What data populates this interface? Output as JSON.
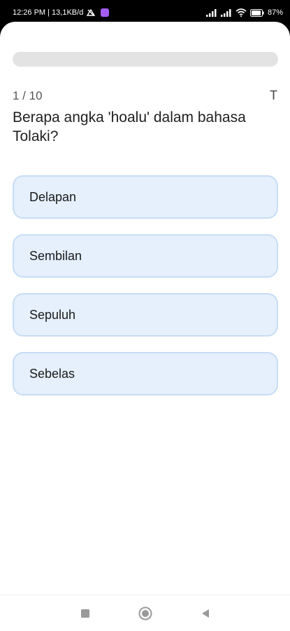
{
  "status_bar": {
    "time_network": "12:26 PM | 13,1KB/d",
    "battery": "87"
  },
  "quiz": {
    "counter": "1 / 10",
    "font_toggle": "T",
    "question": "Berapa angka 'hoalu' dalam bahasa Tolaki?",
    "progress_fraction": 0.0,
    "options": [
      "Delapan",
      "Sembilan",
      "Sepuluh",
      "Sebelas"
    ]
  },
  "nav": {
    "recents_icon": "square-icon",
    "home_icon": "circle-icon",
    "back_icon": "triangle-back-icon"
  },
  "colors": {
    "option_bg": "#e5f0fc",
    "option_border": "#c7ddf6",
    "progress_track": "#e3e3e3"
  }
}
